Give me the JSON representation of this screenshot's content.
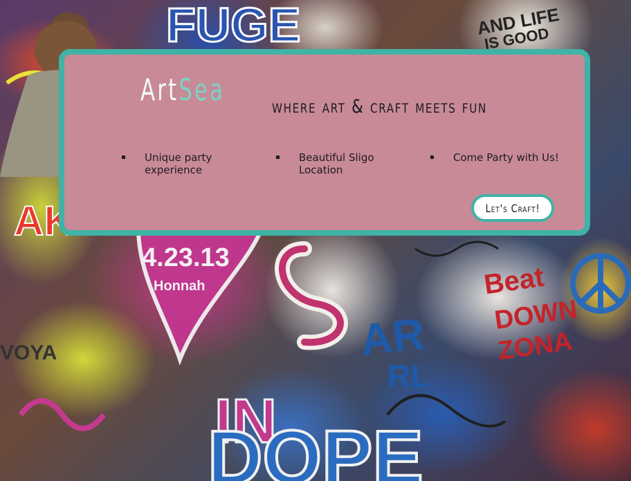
{
  "brand": {
    "name_part1": "Art",
    "name_part2": "Sea"
  },
  "tagline": "where art & craft meets fun",
  "features": [
    {
      "label": "Unique party experience"
    },
    {
      "label": "Beautiful Sligo Location"
    },
    {
      "label": "Come Party with Us!"
    }
  ],
  "cta": {
    "label": "Let's Craft!"
  },
  "colors": {
    "card_bg": "#c88a97",
    "card_border": "#3fb3a6",
    "brand_accent": "#7ed0c4",
    "text": "#1d1a22"
  },
  "background": {
    "description_icon": "graffiti-wall-photo"
  }
}
